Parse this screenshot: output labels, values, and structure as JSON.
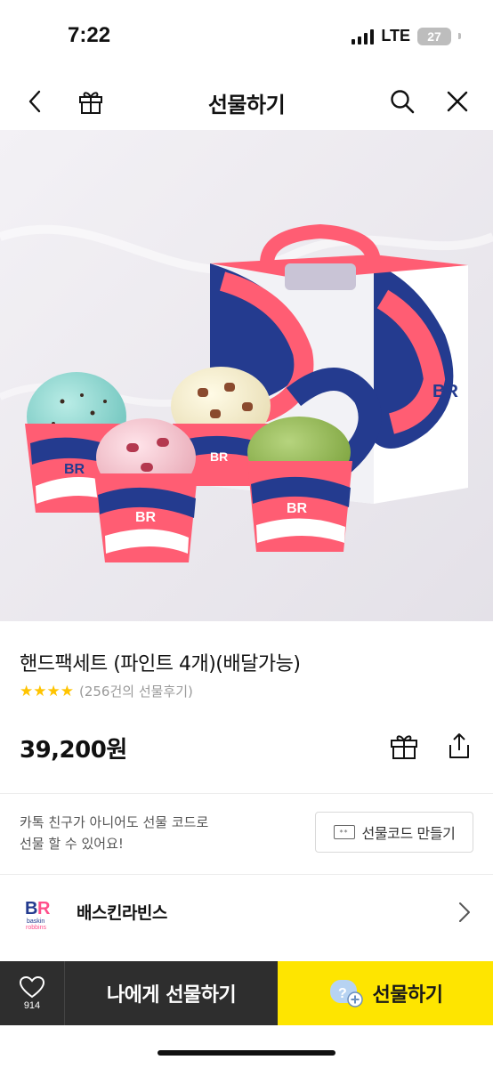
{
  "status_bar": {
    "time": "7:22",
    "network": "LTE",
    "battery": "27"
  },
  "nav": {
    "title": "선물하기",
    "back_icon": "chevron-left-icon",
    "gift_icon": "gift-icon",
    "search_icon": "search-icon",
    "close_icon": "close-icon"
  },
  "product": {
    "title": "핸드팩세트 (파인트 4개)(배달가능)",
    "stars": "★★★★",
    "review_count": "(256건의 선물후기)",
    "price": "39,200원",
    "rating_color": "#ffc400"
  },
  "gift_code": {
    "line1": "카톡 친구가 아니어도 선물 코드로",
    "line2": "선물 할 수 있어요!",
    "button_label": "선물코드 만들기",
    "button_icon_text": "**"
  },
  "brand": {
    "name": "배스킨라빈스",
    "logo_colors": {
      "pink": "#ff4f8b",
      "blue": "#243b8f"
    }
  },
  "bottom_bar": {
    "like_count": "914",
    "self_gift_label": "나에게 선물하기",
    "gift_label": "선물하기",
    "gift_button_color": "#fee500"
  }
}
